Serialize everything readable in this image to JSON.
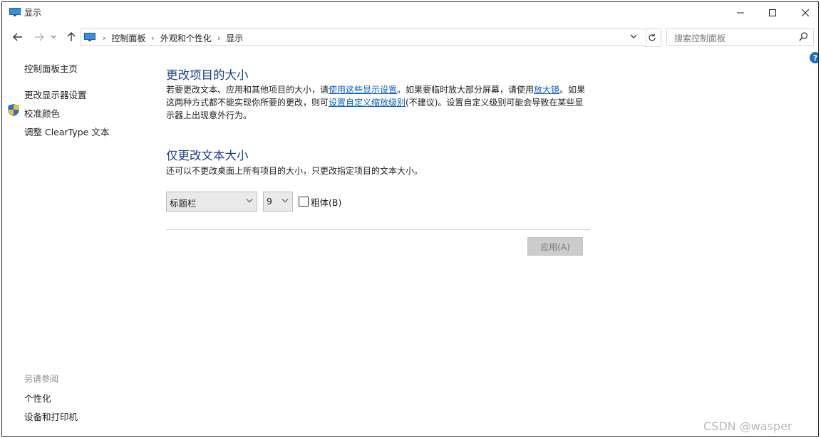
{
  "window": {
    "title": "显示",
    "minimize_icon": "minimize-icon",
    "maximize_icon": "maximize-icon",
    "close_icon": "close-icon"
  },
  "nav": {
    "back_icon": "arrow-left-icon",
    "forward_icon": "arrow-right-icon",
    "recent_icon": "chevron-down-icon",
    "up_icon": "arrow-up-icon"
  },
  "address": {
    "crumbs": [
      "控制面板",
      "外观和个性化",
      "显示"
    ],
    "separator": "›",
    "refresh_icon": "refresh-icon",
    "dropdown_icon": "chevron-down-icon"
  },
  "search": {
    "placeholder": "搜索控制面板",
    "icon": "search-icon"
  },
  "help": {
    "label": "?"
  },
  "sidebar": {
    "home": "控制面板主页",
    "items": [
      {
        "label": "更改显示器设置"
      },
      {
        "label": "校准颜色",
        "icon": "shield-icon"
      },
      {
        "label": "调整 ClearType 文本"
      }
    ],
    "see_also_title": "另请参阅",
    "see_also": [
      {
        "label": "个性化"
      },
      {
        "label": "设备和打印机"
      }
    ]
  },
  "main": {
    "section1": {
      "heading": "更改项目的大小",
      "text_1": "若要更改文本、应用和其他项目的大小，请",
      "link_1": "使用这些显示设置",
      "text_2": "。如果要临时放大部分屏幕，请使用",
      "link_2": "放大镜",
      "text_3": "。如果这两种方式都不能实现你所要的更改，则可",
      "link_3": "设置自定义缩放级别",
      "text_4": "(不建议)。设置自定义级别可能会导致在某些显示器上出现意外行为。"
    },
    "section2": {
      "heading": "仅更改文本大小",
      "desc": "还可以不更改桌面上所有项目的大小，只更改指定项目的文本大小。",
      "item_select": "标题栏",
      "size_select": "9",
      "bold_label": "粗体(B)",
      "bold_checked": false,
      "apply_label": "应用(A)"
    }
  },
  "watermark": "CSDN @wasper"
}
